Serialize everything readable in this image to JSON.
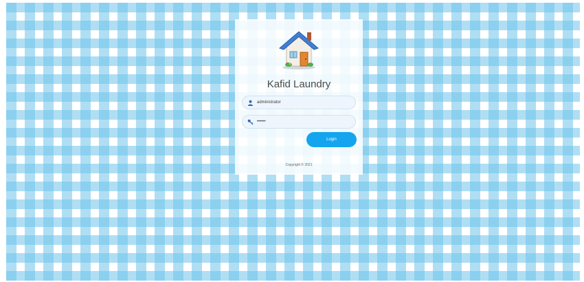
{
  "app": {
    "title": "Kafid Laundry"
  },
  "login_form": {
    "username_value": "administrator",
    "password_value": "••••••",
    "login_label": "Login"
  },
  "footer": {
    "copyright": "Copyright © 2021"
  },
  "icons": {
    "logo": "house-icon",
    "username": "user-icon",
    "password": "key-icon"
  },
  "colors": {
    "accent": "#14a5ee",
    "gingham": "#6ec4eb",
    "field_background": "#eef5fc"
  }
}
